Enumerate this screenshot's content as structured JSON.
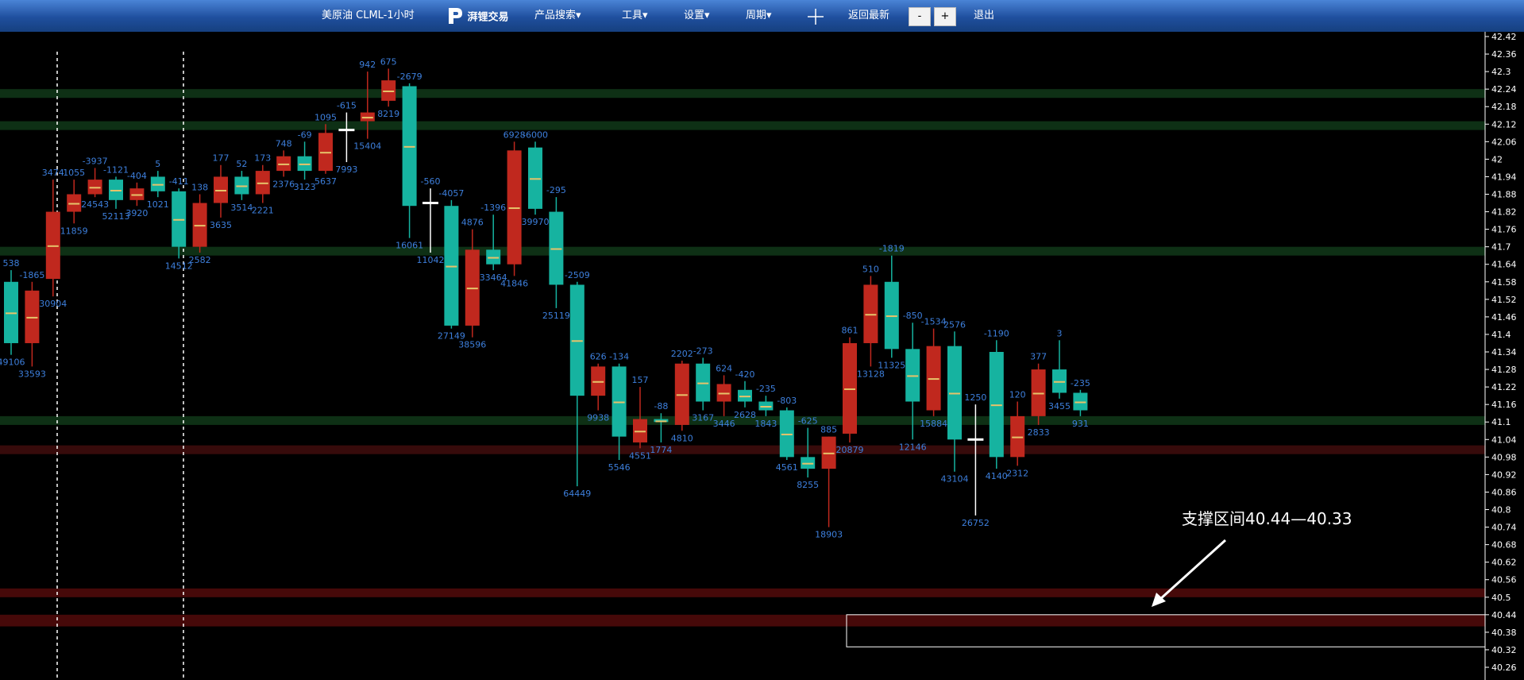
{
  "header": {
    "title": "美原油 CLML-1小时",
    "brand": "湃锂交易",
    "menu": {
      "product_search": "产品搜索▾",
      "tools": "工具▾",
      "settings": "设置▾",
      "period": "周期▾",
      "back_latest": "返回最新",
      "minus": "-",
      "plus": "+",
      "exit": "退出"
    }
  },
  "annotation": "支撑区间40.44—40.33",
  "colors": {
    "up": "#c0281e",
    "down": "#16b3a0",
    "label": "#3d7fdc",
    "res_zone": "#2a1010",
    "sup_zone": "#0f3316"
  },
  "chart_data": {
    "type": "candlestick",
    "symbol": "美原油 CLML-1小时",
    "ylim": [
      40.26,
      42.42
    ],
    "y_ticks": [
      42.42,
      42.36,
      42.3,
      42.24,
      42.18,
      42.12,
      42.06,
      42,
      41.94,
      41.88,
      41.82,
      41.76,
      41.7,
      41.64,
      41.58,
      41.52,
      41.46,
      41.4,
      41.34,
      41.28,
      41.22,
      41.16,
      41.1,
      41.04,
      40.98,
      40.92,
      40.86,
      40.8,
      40.74,
      40.68,
      40.62,
      40.56,
      40.5,
      40.44,
      40.38,
      40.32,
      40.26
    ],
    "zones": [
      {
        "type": "support",
        "y1": 40.5,
        "y2": 40.53
      },
      {
        "type": "support",
        "y1": 40.4,
        "y2": 40.44
      },
      {
        "type": "resistance",
        "y1": 42.24,
        "y2": 42.21
      },
      {
        "type": "resistance",
        "y1": 42.13,
        "y2": 42.1
      },
      {
        "type": "resistance",
        "y1": 41.7,
        "y2": 41.67
      },
      {
        "type": "resistance",
        "y1": 41.12,
        "y2": 41.09
      },
      {
        "type": "support",
        "y1": 41.02,
        "y2": 40.99
      }
    ],
    "target_box": {
      "y1": 40.44,
      "y2": 40.33
    },
    "candles": [
      {
        "o": 41.58,
        "h": 41.62,
        "l": 41.33,
        "c": 41.37,
        "top": "538",
        "bot": "49106",
        "dir": "down"
      },
      {
        "o": 41.37,
        "h": 41.58,
        "l": 41.29,
        "c": 41.55,
        "top": "-1865",
        "bot": "33593",
        "dir": "up"
      },
      {
        "o": 41.59,
        "h": 41.93,
        "l": 41.53,
        "c": 41.82,
        "top": "3474",
        "bot": "30904",
        "dir": "up"
      },
      {
        "o": 41.82,
        "h": 41.93,
        "l": 41.78,
        "c": 41.88,
        "top": "1055",
        "bot": "11859",
        "dir": "up"
      },
      {
        "o": 41.88,
        "h": 41.97,
        "l": 41.87,
        "c": 41.93,
        "top": "-3937",
        "bot": "24543",
        "dir": "up"
      },
      {
        "o": 41.93,
        "h": 41.94,
        "l": 41.83,
        "c": 41.86,
        "top": "-1121",
        "bot": "52113",
        "dir": "down"
      },
      {
        "o": 41.86,
        "h": 41.92,
        "l": 41.84,
        "c": 41.9,
        "top": "-404",
        "bot": "3920",
        "dir": "up"
      },
      {
        "o": 41.94,
        "h": 41.96,
        "l": 41.87,
        "c": 41.89,
        "top": "5",
        "bot": "1021",
        "dir": "down"
      },
      {
        "o": 41.89,
        "h": 41.9,
        "l": 41.66,
        "c": 41.7,
        "top": "-411",
        "bot": "14512",
        "dir": "down"
      },
      {
        "o": 41.7,
        "h": 41.88,
        "l": 41.68,
        "c": 41.85,
        "top": "138",
        "bot": "2582",
        "dir": "up"
      },
      {
        "o": 41.85,
        "h": 41.98,
        "l": 41.8,
        "c": 41.94,
        "top": "177",
        "bot": "3635",
        "dir": "up"
      },
      {
        "o": 41.94,
        "h": 41.96,
        "l": 41.86,
        "c": 41.88,
        "top": "52",
        "bot": "3514",
        "dir": "down"
      },
      {
        "o": 41.88,
        "h": 41.98,
        "l": 41.85,
        "c": 41.96,
        "top": "173",
        "bot": "2221",
        "dir": "up"
      },
      {
        "o": 41.96,
        "h": 42.03,
        "l": 41.94,
        "c": 42.01,
        "top": "748",
        "bot": "2376",
        "dir": "up"
      },
      {
        "o": 42.01,
        "h": 42.06,
        "l": 41.93,
        "c": 41.96,
        "top": "-69",
        "bot": "3123",
        "dir": "down"
      },
      {
        "o": 41.96,
        "h": 42.12,
        "l": 41.95,
        "c": 42.09,
        "top": "1095",
        "bot": "5637",
        "dir": "up"
      },
      {
        "o": 42.14,
        "h": 42.16,
        "l": 41.99,
        "c": 42.1,
        "top": "-615",
        "bot": "7993",
        "dir": "cross"
      },
      {
        "o": 42.13,
        "h": 42.3,
        "l": 42.07,
        "c": 42.16,
        "top": "942",
        "bot": "15404",
        "dir": "up"
      },
      {
        "o": 42.2,
        "h": 42.31,
        "l": 42.18,
        "c": 42.27,
        "top": "675",
        "bot": "8219",
        "dir": "up"
      },
      {
        "o": 42.25,
        "h": 42.26,
        "l": 41.73,
        "c": 41.84,
        "top": "-2679",
        "bot": "16061",
        "dir": "down"
      },
      {
        "o": 41.86,
        "h": 41.9,
        "l": 41.68,
        "c": 41.85,
        "top": "-560",
        "bot": "11042",
        "dir": "cross"
      },
      {
        "o": 41.84,
        "h": 41.86,
        "l": 41.42,
        "c": 41.43,
        "top": "-4057",
        "bot": "27149",
        "dir": "down"
      },
      {
        "o": 41.43,
        "h": 41.76,
        "l": 41.39,
        "c": 41.69,
        "top": "4876",
        "bot": "38596",
        "dir": "up"
      },
      {
        "o": 41.69,
        "h": 41.81,
        "l": 41.62,
        "c": 41.64,
        "top": "-1396",
        "bot": "33464",
        "dir": "down"
      },
      {
        "o": 41.64,
        "h": 42.06,
        "l": 41.6,
        "c": 42.03,
        "top": "6928",
        "bot": "41846",
        "dir": "up"
      },
      {
        "o": 42.04,
        "h": 42.06,
        "l": 41.81,
        "c": 41.83,
        "top": "-6000",
        "bot": "39970",
        "dir": "down"
      },
      {
        "o": 41.82,
        "h": 41.87,
        "l": 41.49,
        "c": 41.57,
        "top": "-295",
        "bot": "25119",
        "dir": "down"
      },
      {
        "o": 41.57,
        "h": 41.58,
        "l": 40.88,
        "c": 41.19,
        "top": "-2509",
        "bot": "64449",
        "dir": "down"
      },
      {
        "o": 41.19,
        "h": 41.3,
        "l": 41.14,
        "c": 41.29,
        "top": "626",
        "bot": "9938",
        "dir": "up"
      },
      {
        "o": 41.29,
        "h": 41.3,
        "l": 40.97,
        "c": 41.05,
        "top": "-134",
        "bot": "5546",
        "dir": "down"
      },
      {
        "o": 41.03,
        "h": 41.22,
        "l": 41.01,
        "c": 41.11,
        "top": "157",
        "bot": "4551",
        "dir": "up"
      },
      {
        "o": 41.11,
        "h": 41.13,
        "l": 41.03,
        "c": 41.1,
        "top": "-88",
        "bot": "1774",
        "dir": "down"
      },
      {
        "o": 41.09,
        "h": 41.31,
        "l": 41.07,
        "c": 41.3,
        "top": "2202",
        "bot": "4810",
        "dir": "up"
      },
      {
        "o": 41.3,
        "h": 41.32,
        "l": 41.14,
        "c": 41.17,
        "top": "-273",
        "bot": "3167",
        "dir": "down"
      },
      {
        "o": 41.17,
        "h": 41.26,
        "l": 41.12,
        "c": 41.23,
        "top": "624",
        "bot": "3446",
        "dir": "up"
      },
      {
        "o": 41.21,
        "h": 41.24,
        "l": 41.15,
        "c": 41.17,
        "top": "-420",
        "bot": "2628",
        "dir": "down"
      },
      {
        "o": 41.17,
        "h": 41.19,
        "l": 41.12,
        "c": 41.14,
        "top": "-235",
        "bot": "1843",
        "dir": "down"
      },
      {
        "o": 41.14,
        "h": 41.15,
        "l": 40.97,
        "c": 40.98,
        "top": "-803",
        "bot": "4561",
        "dir": "down"
      },
      {
        "o": 40.98,
        "h": 41.08,
        "l": 40.91,
        "c": 40.94,
        "top": "-625",
        "bot": "8255",
        "dir": "down"
      },
      {
        "o": 40.94,
        "h": 41.05,
        "l": 40.74,
        "c": 41.05,
        "top": "885",
        "bot": "18903",
        "dir": "up"
      },
      {
        "o": 41.06,
        "h": 41.39,
        "l": 41.03,
        "c": 41.37,
        "top": "861",
        "bot": "20879",
        "dir": "up"
      },
      {
        "o": 41.37,
        "h": 41.6,
        "l": 41.29,
        "c": 41.57,
        "top": "510",
        "bot": "13128",
        "dir": "up"
      },
      {
        "o": 41.58,
        "h": 41.67,
        "l": 41.32,
        "c": 41.35,
        "top": "-1819",
        "bot": "11325",
        "dir": "down"
      },
      {
        "o": 41.35,
        "h": 41.44,
        "l": 41.04,
        "c": 41.17,
        "top": "-850",
        "bot": "12146",
        "dir": "down"
      },
      {
        "o": 41.14,
        "h": 41.42,
        "l": 41.12,
        "c": 41.36,
        "top": "-1534",
        "bot": "15884",
        "dir": "up"
      },
      {
        "o": 41.36,
        "h": 41.41,
        "l": 40.93,
        "c": 41.04,
        "top": "2576",
        "bot": "43104",
        "dir": "down"
      },
      {
        "o": 41.04,
        "h": 41.16,
        "l": 40.78,
        "c": 41.04,
        "top": "1250",
        "bot": "26752",
        "dir": "cross"
      },
      {
        "o": 41.34,
        "h": 41.38,
        "l": 40.94,
        "c": 40.98,
        "top": "-1190",
        "bot": "4140",
        "dir": "down"
      },
      {
        "o": 40.98,
        "h": 41.17,
        "l": 40.95,
        "c": 41.12,
        "top": "120",
        "bot": "2312",
        "dir": "up"
      },
      {
        "o": 41.12,
        "h": 41.3,
        "l": 41.09,
        "c": 41.28,
        "top": "377",
        "bot": "2833",
        "dir": "up"
      },
      {
        "o": 41.28,
        "h": 41.38,
        "l": 41.18,
        "c": 41.2,
        "top": "3",
        "bot": "3455",
        "dir": "down"
      },
      {
        "o": 41.2,
        "h": 41.21,
        "l": 41.12,
        "c": 41.14,
        "top": "-235",
        "bot": "931",
        "dir": "down"
      }
    ]
  }
}
